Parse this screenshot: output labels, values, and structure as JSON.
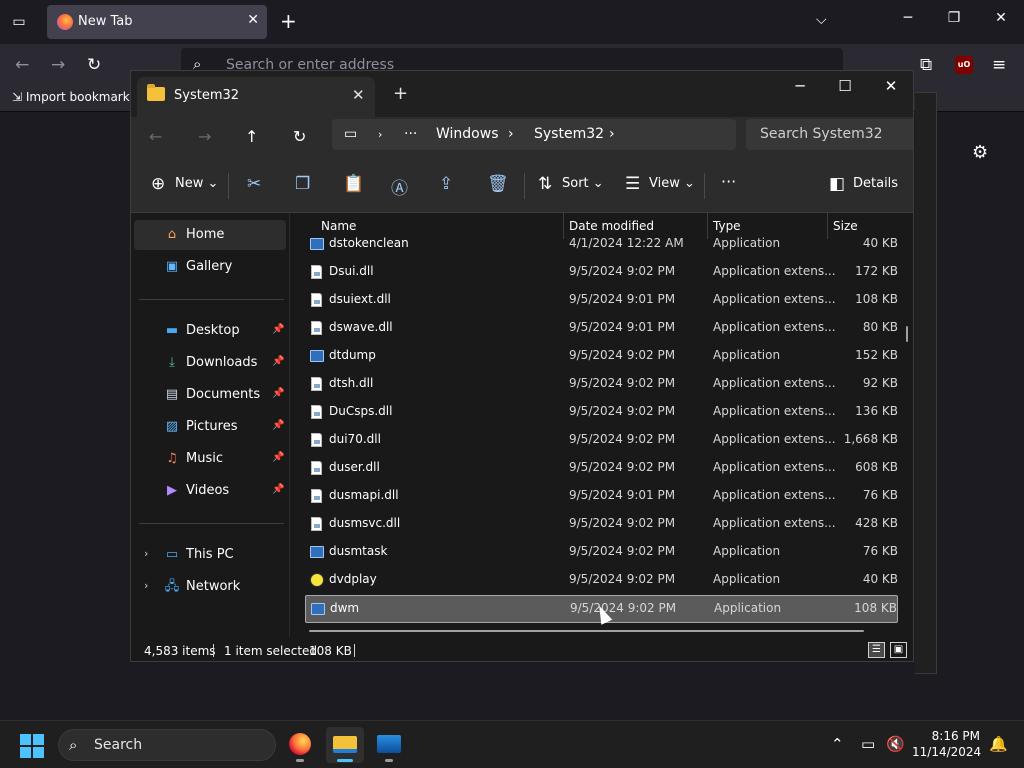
{
  "firefox": {
    "tab_title": "New Tab",
    "url_placeholder": "Search or enter address",
    "bookmark_import": "Import bookmarks...",
    "icons": {
      "tab_list": "tab-list-icon",
      "settings": "gear-icon",
      "ublock": "ublock-origin-icon"
    },
    "ublock_label": "uO"
  },
  "explorer": {
    "tab_title": "System32",
    "breadcrumb": [
      "Windows",
      "System32"
    ],
    "search_placeholder": "Search System32",
    "toolbar": {
      "new": "New",
      "sort": "Sort",
      "view": "View",
      "details": "Details"
    },
    "nav": {
      "home": "Home",
      "gallery": "Gallery",
      "desktop": "Desktop",
      "downloads": "Downloads",
      "documents": "Documents",
      "pictures": "Pictures",
      "music": "Music",
      "videos": "Videos",
      "this_pc": "This PC",
      "network": "Network"
    },
    "columns": {
      "name": "Name",
      "date": "Date modified",
      "type": "Type",
      "size": "Size"
    },
    "files": [
      {
        "name": "dstokenclean",
        "date": "4/1/2024 12:22 AM",
        "type": "Application",
        "size": "40 KB",
        "kind": "exe"
      },
      {
        "name": "Dsui.dll",
        "date": "9/5/2024 9:02 PM",
        "type": "Application extens...",
        "size": "172 KB",
        "kind": "dll"
      },
      {
        "name": "dsuiext.dll",
        "date": "9/5/2024 9:01 PM",
        "type": "Application extens...",
        "size": "108 KB",
        "kind": "dll"
      },
      {
        "name": "dswave.dll",
        "date": "9/5/2024 9:01 PM",
        "type": "Application extens...",
        "size": "80 KB",
        "kind": "dll"
      },
      {
        "name": "dtdump",
        "date": "9/5/2024 9:02 PM",
        "type": "Application",
        "size": "152 KB",
        "kind": "exe"
      },
      {
        "name": "dtsh.dll",
        "date": "9/5/2024 9:02 PM",
        "type": "Application extens...",
        "size": "92 KB",
        "kind": "dll"
      },
      {
        "name": "DuCsps.dll",
        "date": "9/5/2024 9:02 PM",
        "type": "Application extens...",
        "size": "136 KB",
        "kind": "dll"
      },
      {
        "name": "dui70.dll",
        "date": "9/5/2024 9:02 PM",
        "type": "Application extens...",
        "size": "1,668 KB",
        "kind": "dll"
      },
      {
        "name": "duser.dll",
        "date": "9/5/2024 9:02 PM",
        "type": "Application extens...",
        "size": "608 KB",
        "kind": "dll"
      },
      {
        "name": "dusmapi.dll",
        "date": "9/5/2024 9:01 PM",
        "type": "Application extens...",
        "size": "76 KB",
        "kind": "dll"
      },
      {
        "name": "dusmsvc.dll",
        "date": "9/5/2024 9:02 PM",
        "type": "Application extens...",
        "size": "428 KB",
        "kind": "dll"
      },
      {
        "name": "dusmtask",
        "date": "9/5/2024 9:02 PM",
        "type": "Application",
        "size": "76 KB",
        "kind": "exe"
      },
      {
        "name": "dvdplay",
        "date": "9/5/2024 9:02 PM",
        "type": "Application",
        "size": "40 KB",
        "kind": "dvd"
      },
      {
        "name": "dwm",
        "date": "9/5/2024 9:02 PM",
        "type": "Application",
        "size": "108 KB",
        "kind": "exe",
        "selected": true
      }
    ],
    "status": {
      "item_count": "4,583 items",
      "selection": "1 item selected",
      "selection_size": "108 KB"
    }
  },
  "taskbar": {
    "search_label": "Search",
    "time": "8:16 PM",
    "date": "11/14/2024",
    "accent": "#4cc2ff"
  }
}
